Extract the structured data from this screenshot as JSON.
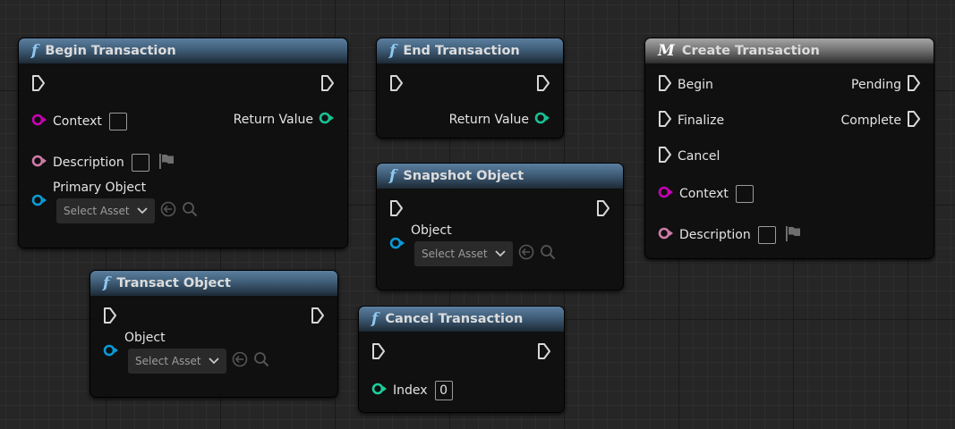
{
  "colors": {
    "exec": "#d8d8d8",
    "object_context": "#c800b4",
    "string": "#d07aa8",
    "object": "#0a9ad8",
    "int": "#1bd0a0",
    "return": "#1bc094"
  },
  "nodes": [
    {
      "id": "begin-transaction",
      "title": "Begin Transaction",
      "kind": "function",
      "icon": "f",
      "pins": [
        {
          "side": "in",
          "type": "exec",
          "label": ""
        },
        {
          "side": "out",
          "type": "exec",
          "label": ""
        },
        {
          "side": "in",
          "type": "data",
          "color": "object_context",
          "label": "Context",
          "widget": "box"
        },
        {
          "side": "out",
          "type": "data",
          "color": "return",
          "label": "Return Value"
        },
        {
          "side": "in",
          "type": "data",
          "color": "string",
          "label": "Description",
          "widget": "box-flag"
        },
        {
          "side": "in",
          "type": "data",
          "color": "object",
          "label": "Primary Object",
          "widget": "asset",
          "asset_label": "Select Asset"
        }
      ]
    },
    {
      "id": "end-transaction",
      "title": "End Transaction",
      "kind": "function",
      "icon": "f",
      "pins": [
        {
          "side": "in",
          "type": "exec",
          "label": ""
        },
        {
          "side": "out",
          "type": "exec",
          "label": ""
        },
        {
          "side": "out",
          "type": "data",
          "color": "return",
          "label": "Return Value"
        }
      ]
    },
    {
      "id": "create-transaction",
      "title": "Create Transaction",
      "kind": "macro",
      "icon": "M",
      "pins": [
        {
          "side": "in",
          "type": "exec",
          "label": "Begin"
        },
        {
          "side": "out",
          "type": "exec",
          "label": "Pending"
        },
        {
          "side": "in",
          "type": "exec",
          "label": "Finalize"
        },
        {
          "side": "out",
          "type": "exec",
          "label": "Complete"
        },
        {
          "side": "in",
          "type": "exec",
          "label": "Cancel"
        },
        {
          "side": "in",
          "type": "data",
          "color": "object_context",
          "label": "Context",
          "widget": "box"
        },
        {
          "side": "in",
          "type": "data",
          "color": "string",
          "label": "Description",
          "widget": "box-flag"
        }
      ]
    },
    {
      "id": "snapshot-object",
      "title": "Snapshot Object",
      "kind": "function",
      "icon": "f",
      "pins": [
        {
          "side": "in",
          "type": "exec",
          "label": ""
        },
        {
          "side": "out",
          "type": "exec",
          "label": ""
        },
        {
          "side": "in",
          "type": "data",
          "color": "object",
          "label": "Object",
          "widget": "asset",
          "asset_label": "Select Asset"
        }
      ]
    },
    {
      "id": "transact-object",
      "title": "Transact Object",
      "kind": "function",
      "icon": "f",
      "pins": [
        {
          "side": "in",
          "type": "exec",
          "label": ""
        },
        {
          "side": "out",
          "type": "exec",
          "label": ""
        },
        {
          "side": "in",
          "type": "data",
          "color": "object",
          "label": "Object",
          "widget": "asset",
          "asset_label": "Select Asset"
        }
      ]
    },
    {
      "id": "cancel-transaction",
      "title": "Cancel Transaction",
      "kind": "function",
      "icon": "f",
      "pins": [
        {
          "side": "in",
          "type": "exec",
          "label": ""
        },
        {
          "side": "out",
          "type": "exec",
          "label": ""
        },
        {
          "side": "in",
          "type": "data",
          "color": "int",
          "label": "Index",
          "widget": "number",
          "value": "0"
        }
      ]
    }
  ]
}
